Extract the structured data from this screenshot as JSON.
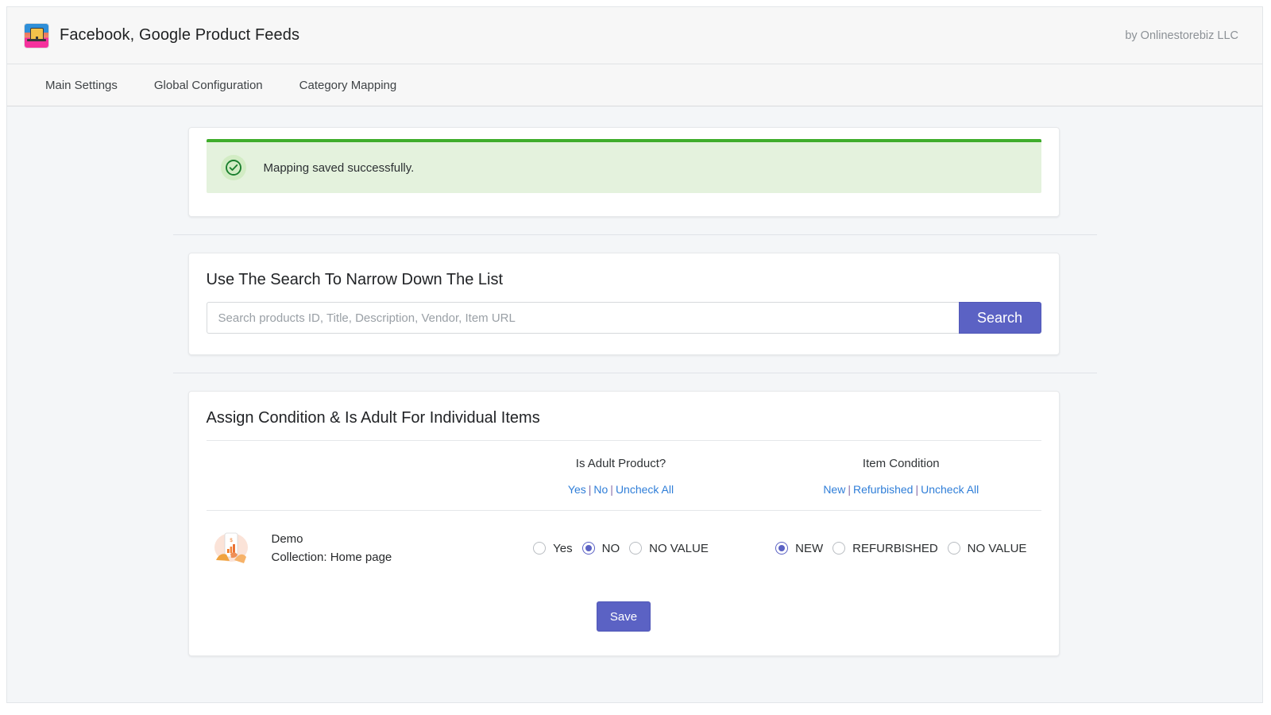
{
  "header": {
    "logo_icon": "shop-app-icon",
    "title": "Facebook, Google Product Feeds",
    "byline": "by Onlinestorebiz LLC"
  },
  "nav": {
    "tabs": [
      {
        "label": "Main Settings"
      },
      {
        "label": "Global Configuration"
      },
      {
        "label": "Category Mapping"
      }
    ]
  },
  "alert": {
    "icon": "check-circle-icon",
    "message": "Mapping saved successfully.",
    "accent_color": "#3fad2b",
    "background_color": "#e4f2dd"
  },
  "search": {
    "heading": "Use The Search To Narrow Down The List",
    "placeholder": "Search products ID, Title, Description, Vendor, Item URL",
    "value": "",
    "button_label": "Search",
    "button_color": "#5b62c4"
  },
  "assign": {
    "heading": "Assign Condition & Is Adult For Individual Items",
    "columns": {
      "product": "",
      "adult": "Is Adult Product?",
      "condition": "Item Condition"
    },
    "adult_quick_links": [
      {
        "label": "Yes"
      },
      {
        "label": "No"
      },
      {
        "label": "Uncheck All"
      }
    ],
    "condition_quick_links": [
      {
        "label": "New"
      },
      {
        "label": "Refurbished"
      },
      {
        "label": "Uncheck All"
      }
    ],
    "separator": "|",
    "link_color": "#2f7ed8",
    "rows": [
      {
        "thumb_icon": "product-thumbnail-phone-chart",
        "title": "Demo",
        "subtitle": "Collection: Home page",
        "adult_options": [
          {
            "label": "Yes",
            "checked": false
          },
          {
            "label": "NO",
            "checked": true
          },
          {
            "label": "NO VALUE",
            "checked": false
          }
        ],
        "condition_options": [
          {
            "label": "NEW",
            "checked": true
          },
          {
            "label": "REFURBISHED",
            "checked": false
          },
          {
            "label": "NO VALUE",
            "checked": false
          }
        ]
      }
    ],
    "save_label": "Save"
  }
}
